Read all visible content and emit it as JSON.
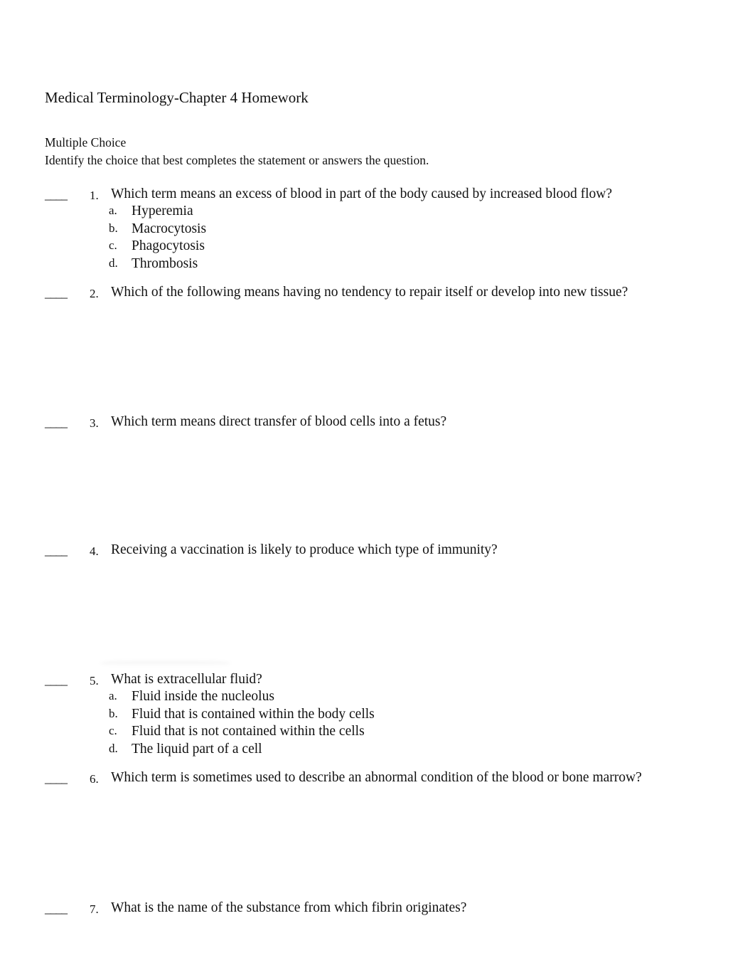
{
  "document": {
    "title": "Medical Terminology-Chapter 4 Homework",
    "section_title": "Multiple Choice",
    "instructions": "Identify the choice that best completes the statement or answers the question.",
    "answer_blank": "____"
  },
  "questions": [
    {
      "number": "1.",
      "text": "Which term means an excess of blood in part of the body caused by increased blood flow?",
      "choices": [
        {
          "letter": "a.",
          "text": "Hyperemia"
        },
        {
          "letter": "b.",
          "text": "Macrocytosis"
        },
        {
          "letter": "c.",
          "text": "Phagocytosis"
        },
        {
          "letter": "d.",
          "text": "Thrombosis"
        }
      ]
    },
    {
      "number": "2.",
      "text": "Which of the following means having no tendency to repair itself or develop into new tissue?",
      "choices": []
    },
    {
      "number": "3.",
      "text": "Which term means direct transfer of blood cells into a fetus?",
      "choices": []
    },
    {
      "number": "4.",
      "text": "Receiving a vaccination is likely to produce which type of immunity?",
      "choices": []
    },
    {
      "number": "5.",
      "text": "What is extracellular fluid?",
      "choices": [
        {
          "letter": "a.",
          "text": "Fluid inside the nucleolus"
        },
        {
          "letter": "b.",
          "text": "Fluid that is contained within the body cells"
        },
        {
          "letter": "c.",
          "text": "Fluid that is not contained within the cells"
        },
        {
          "letter": "d.",
          "text": "The liquid part of a cell"
        }
      ]
    },
    {
      "number": "6.",
      "text": "Which term is sometimes used to describe an abnormal condition of the blood or bone marrow?",
      "choices": []
    },
    {
      "number": "7.",
      "text": "What is the name of the substance from which fibrin originates?",
      "choices": []
    }
  ]
}
